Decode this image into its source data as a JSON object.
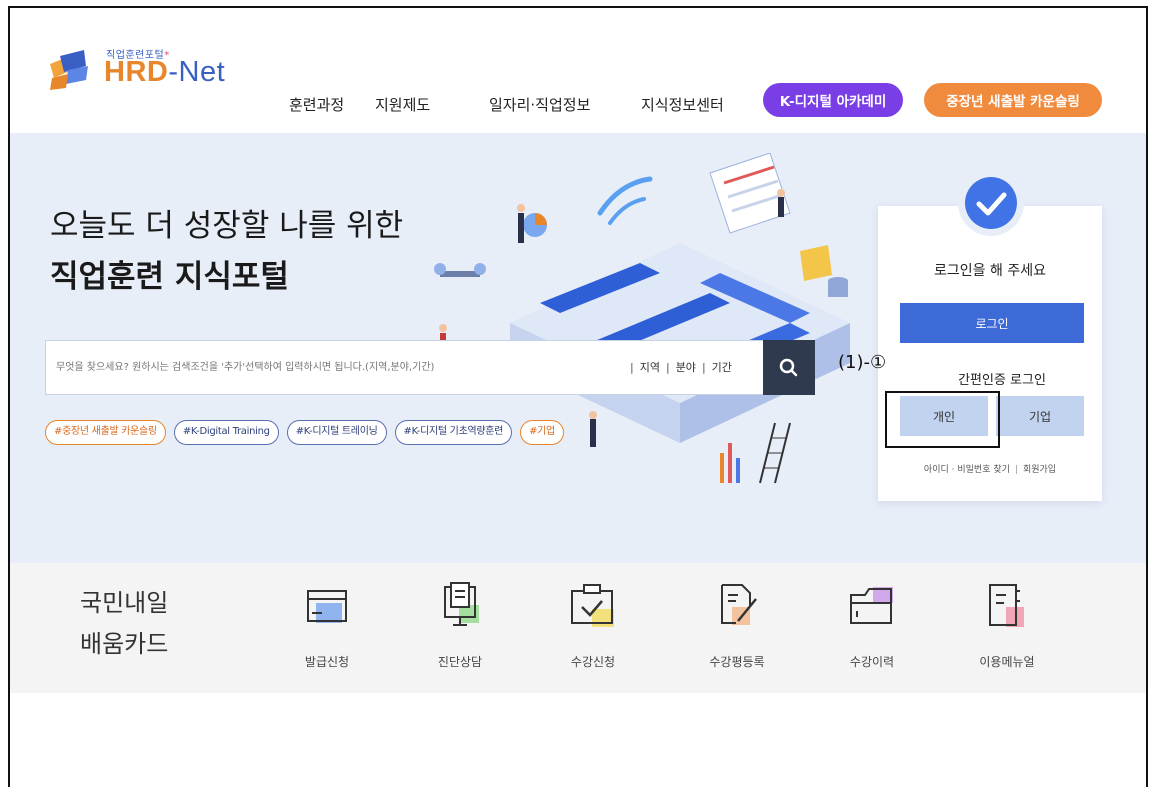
{
  "header": {
    "logo": {
      "sub": "직업훈련포털",
      "hrd": "HRD",
      "dash": "-",
      "net": "Net"
    },
    "nav": [
      "훈련과정",
      "지원제도",
      "일자리·직업정보",
      "지식정보센터"
    ],
    "pill_digital": "K-디지털 아카데미",
    "pill_counsel": "중장년 새출발 카운슬링"
  },
  "hero": {
    "title_line1": "오늘도 더 성장할 나를 위한",
    "title_line2": "직업훈련 지식포털",
    "search": {
      "placeholder": "무엇을 찾으세요? 원하시는 검색조건을 '추가'선택하여 입력하시면 됩니다.(지역,분야,기간)",
      "filters": [
        "지역",
        "분야",
        "기간"
      ],
      "search_icon": "search-icon"
    },
    "tags": [
      "#중장년 새출발 카운슬링",
      "#K-Digital Training",
      "#K-디지털 트레이닝",
      "#K-디지털 기초역량훈련",
      "#기업"
    ]
  },
  "login": {
    "message": "로그인을 해 주세요",
    "login_button": "로그인",
    "easy_label": "간편인증 로그인",
    "personal": "개인",
    "company": "기업",
    "find_link": "아이디 · 비밀번호 찾기",
    "signup_link": "회원가입"
  },
  "annotation": {
    "label": "(1)-①"
  },
  "card": {
    "title_line1": "국민내일",
    "title_line2": "배움카드",
    "items": [
      {
        "label": "발급신청",
        "icon": "card-icon"
      },
      {
        "label": "진단상담",
        "icon": "monitor-icon"
      },
      {
        "label": "수강신청",
        "icon": "clipboard-check-icon"
      },
      {
        "label": "수강평등록",
        "icon": "document-edit-icon"
      },
      {
        "label": "수강이력",
        "icon": "folder-icon"
      },
      {
        "label": "이용메뉴얼",
        "icon": "manual-book-icon"
      }
    ]
  },
  "colors": {
    "brand_orange": "#e8862c",
    "brand_blue": "#3a5fc4",
    "pill_purple": "#7a3ee6",
    "pill_orange": "#f08a3c",
    "login_blue": "#3d6ad6",
    "easy_btn": "#c2d3ef",
    "hero_bg": "#e8eef8",
    "search_btn": "#2f3a4f"
  }
}
